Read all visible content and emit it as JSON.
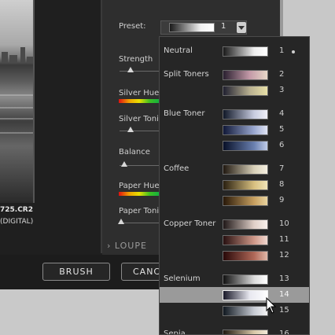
{
  "photo": {
    "filename": "725.CR2",
    "type": "(DIGITAL)"
  },
  "settings": {
    "preset_label": "Preset:",
    "preset_value": "1",
    "strength_label": "Strength",
    "silver_hue_label": "Silver Hue",
    "silver_tone_label": "Silver Toni",
    "balance_label": "Balance",
    "paper_hue_label": "Paper Hue",
    "paper_tone_label": "Paper Toni",
    "loupe_label": "LOUPE"
  },
  "buttons": {
    "brush": "BRUSH",
    "cancel": "CANC"
  },
  "dropdown": {
    "groups": [
      {
        "name": "Neutral",
        "options": [
          {
            "num": "1",
            "selected": true
          }
        ]
      },
      {
        "name": "Split Toners",
        "options": [
          {
            "num": "2"
          },
          {
            "num": "3"
          }
        ]
      },
      {
        "name": "Blue Toner",
        "options": [
          {
            "num": "4"
          },
          {
            "num": "5"
          },
          {
            "num": "6"
          }
        ]
      },
      {
        "name": "Coffee",
        "options": [
          {
            "num": "7"
          },
          {
            "num": "8"
          },
          {
            "num": "9"
          }
        ]
      },
      {
        "name": "Copper Toner",
        "options": [
          {
            "num": "10"
          },
          {
            "num": "11"
          },
          {
            "num": "12"
          }
        ]
      },
      {
        "name": "Selenium",
        "options": [
          {
            "num": "13"
          },
          {
            "num": "14",
            "highlighted": true
          },
          {
            "num": "15"
          }
        ]
      },
      {
        "name": "Sepia",
        "options": [
          {
            "num": "16"
          }
        ]
      }
    ]
  },
  "colors": {
    "hover_highlight": "#9a9a9a",
    "panel_bg": "#2e2e2e",
    "dropdown_bg": "#262626"
  }
}
